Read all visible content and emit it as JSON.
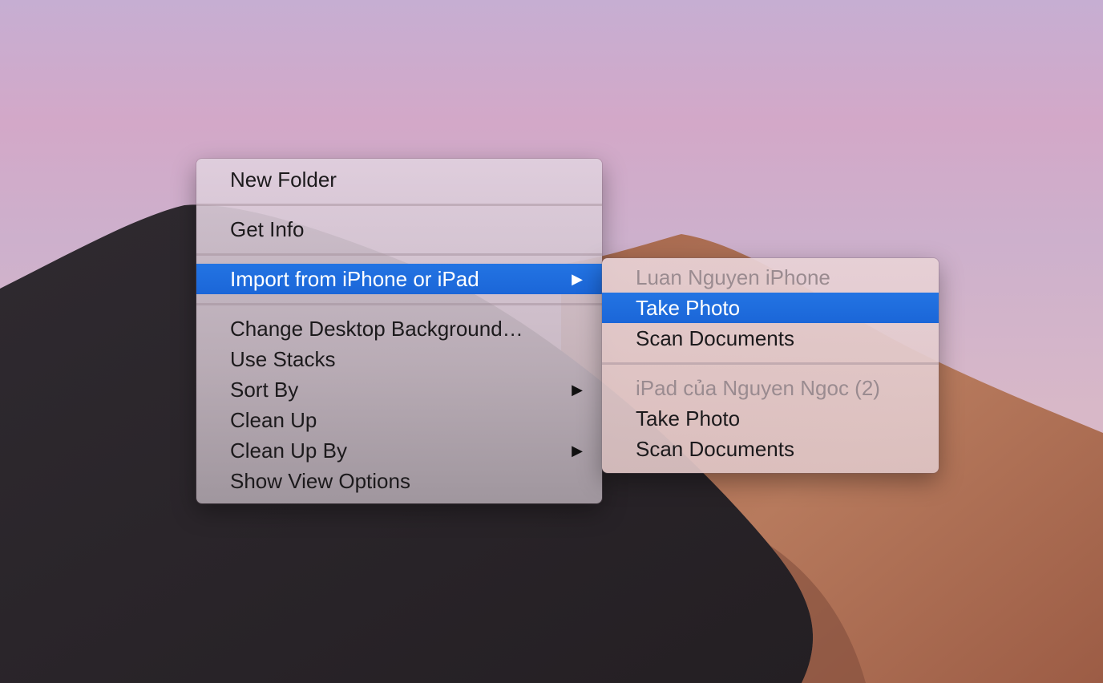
{
  "context_menu": {
    "items": [
      {
        "label": "New Folder"
      },
      {
        "label": "Get Info"
      },
      {
        "label": "Import from iPhone or iPad",
        "submenu": true,
        "highlighted": true
      },
      {
        "label": "Change Desktop Background…"
      },
      {
        "label": "Use Stacks"
      },
      {
        "label": "Sort By",
        "submenu": true
      },
      {
        "label": "Clean Up"
      },
      {
        "label": "Clean Up By",
        "submenu": true
      },
      {
        "label": "Show View Options"
      }
    ],
    "arrow_glyph": "▶"
  },
  "submenu": {
    "groups": [
      {
        "device": "Luan Nguyen iPhone",
        "items": [
          {
            "label": "Take Photo",
            "highlighted": true
          },
          {
            "label": "Scan Documents"
          }
        ]
      },
      {
        "device": "iPad của Nguyen Ngoc (2)",
        "items": [
          {
            "label": "Take Photo"
          },
          {
            "label": "Scan Documents"
          }
        ]
      }
    ]
  },
  "colors": {
    "highlight": "#1b66d8",
    "sky_top": "#c7aed0",
    "sky_pink": "#d8a9c6",
    "dune_dark": "#3a2f34",
    "dune_orange": "#b0705a"
  }
}
